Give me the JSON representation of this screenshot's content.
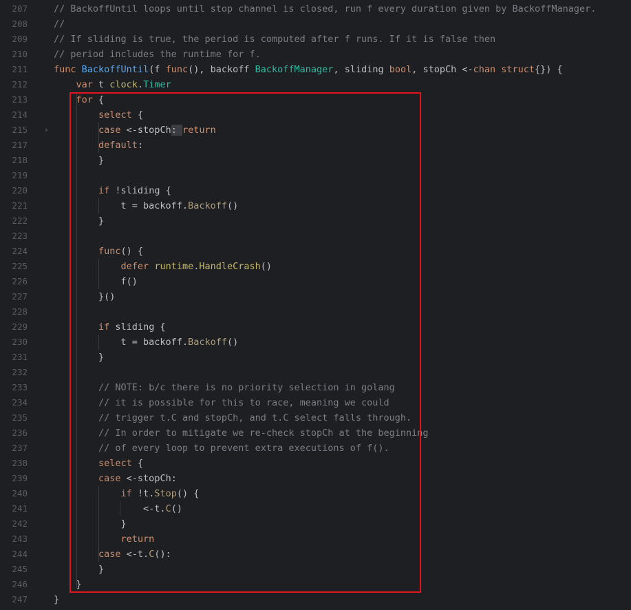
{
  "editor": {
    "lines": [
      {
        "n": "207",
        "tokens": [
          [
            "cm",
            "// BackoffUntil loops until stop channel is closed, run f every duration given by BackoffManager."
          ]
        ]
      },
      {
        "n": "208",
        "tokens": [
          [
            "cm",
            "//"
          ]
        ]
      },
      {
        "n": "209",
        "tokens": [
          [
            "cm",
            "// If sliding is true, the period is computed after f runs. If it is false then"
          ]
        ]
      },
      {
        "n": "210",
        "tokens": [
          [
            "cm",
            "// period includes the runtime for f."
          ]
        ]
      },
      {
        "n": "211",
        "tokens": [
          [
            "kw",
            "func "
          ],
          [
            "fn",
            "BackoffUntil"
          ],
          [
            "",
            "(f "
          ],
          [
            "kw",
            "func"
          ],
          [
            "",
            "(), backoff "
          ],
          [
            "ty",
            "BackoffManager"
          ],
          [
            "",
            ", sliding "
          ],
          [
            "kw",
            "bool"
          ],
          [
            "",
            ", stopCh <-"
          ],
          [
            "kw",
            "chan struct"
          ],
          [
            "",
            "{}) {"
          ]
        ]
      },
      {
        "n": "212",
        "tokens": [
          [
            "",
            "    "
          ],
          [
            "kw",
            "var"
          ],
          [
            "",
            " t "
          ],
          [
            "cl",
            "clock"
          ],
          [
            "",
            "."
          ],
          [
            "ty",
            "Timer"
          ]
        ]
      },
      {
        "n": "213",
        "tokens": [
          [
            "",
            "    "
          ],
          [
            "kw",
            "for"
          ],
          [
            "",
            " {"
          ]
        ]
      },
      {
        "n": "214",
        "tokens": [
          [
            "",
            "        "
          ],
          [
            "kw",
            "select"
          ],
          [
            "",
            " {"
          ]
        ]
      },
      {
        "n": "215",
        "fold": true,
        "tokens": [
          [
            "",
            "        "
          ],
          [
            "kw",
            "case"
          ],
          [
            "",
            " <-stopCh"
          ],
          [
            "hl",
            ": "
          ],
          [
            "kw",
            "return"
          ]
        ]
      },
      {
        "n": "217",
        "tokens": [
          [
            "",
            "        "
          ],
          [
            "kw",
            "default"
          ],
          [
            "",
            ":"
          ]
        ]
      },
      {
        "n": "218",
        "tokens": [
          [
            "",
            "        }"
          ]
        ]
      },
      {
        "n": "219",
        "tokens": []
      },
      {
        "n": "220",
        "tokens": [
          [
            "",
            "        "
          ],
          [
            "kw",
            "if"
          ],
          [
            "",
            " !sliding {"
          ]
        ]
      },
      {
        "n": "221",
        "tokens": [
          [
            "",
            "            t = backoff."
          ],
          [
            "mt",
            "Backoff"
          ],
          [
            "",
            "()"
          ]
        ]
      },
      {
        "n": "222",
        "tokens": [
          [
            "",
            "        }"
          ]
        ]
      },
      {
        "n": "223",
        "tokens": []
      },
      {
        "n": "224",
        "tokens": [
          [
            "",
            "        "
          ],
          [
            "kw",
            "func"
          ],
          [
            "",
            "() {"
          ]
        ]
      },
      {
        "n": "225",
        "tokens": [
          [
            "",
            "            "
          ],
          [
            "kw",
            "defer "
          ],
          [
            "cl",
            "runtime"
          ],
          [
            "",
            "."
          ],
          [
            "cl",
            "HandleCrash"
          ],
          [
            "",
            "()"
          ]
        ]
      },
      {
        "n": "226",
        "tokens": [
          [
            "",
            "            f()"
          ]
        ]
      },
      {
        "n": "227",
        "tokens": [
          [
            "",
            "        }()"
          ]
        ]
      },
      {
        "n": "228",
        "tokens": []
      },
      {
        "n": "229",
        "tokens": [
          [
            "",
            "        "
          ],
          [
            "kw",
            "if"
          ],
          [
            "",
            " sliding {"
          ]
        ]
      },
      {
        "n": "230",
        "tokens": [
          [
            "",
            "            t = backoff."
          ],
          [
            "mt",
            "Backoff"
          ],
          [
            "",
            "()"
          ]
        ]
      },
      {
        "n": "231",
        "tokens": [
          [
            "",
            "        }"
          ]
        ]
      },
      {
        "n": "232",
        "tokens": []
      },
      {
        "n": "233",
        "tokens": [
          [
            "",
            "        "
          ],
          [
            "cm",
            "// NOTE: b/c there is no priority selection in golang"
          ]
        ]
      },
      {
        "n": "234",
        "tokens": [
          [
            "",
            "        "
          ],
          [
            "cm",
            "// it is possible for this to race, meaning we could"
          ]
        ]
      },
      {
        "n": "235",
        "tokens": [
          [
            "",
            "        "
          ],
          [
            "cm",
            "// trigger t.C and stopCh, and t.C select falls through."
          ]
        ]
      },
      {
        "n": "236",
        "tokens": [
          [
            "",
            "        "
          ],
          [
            "cm",
            "// In order to mitigate we re-check stopCh at the beginning"
          ]
        ]
      },
      {
        "n": "237",
        "tokens": [
          [
            "",
            "        "
          ],
          [
            "cm",
            "// of every loop to prevent extra executions of f()."
          ]
        ]
      },
      {
        "n": "238",
        "tokens": [
          [
            "",
            "        "
          ],
          [
            "kw",
            "select"
          ],
          [
            "",
            " {"
          ]
        ]
      },
      {
        "n": "239",
        "tokens": [
          [
            "",
            "        "
          ],
          [
            "kw",
            "case"
          ],
          [
            "",
            " <-stopCh:"
          ]
        ]
      },
      {
        "n": "240",
        "tokens": [
          [
            "",
            "            "
          ],
          [
            "kw",
            "if"
          ],
          [
            "",
            " !t."
          ],
          [
            "mt",
            "Stop"
          ],
          [
            "",
            "() {"
          ]
        ]
      },
      {
        "n": "241",
        "tokens": [
          [
            "",
            "                <-t."
          ],
          [
            "mt",
            "C"
          ],
          [
            "",
            "()"
          ]
        ]
      },
      {
        "n": "242",
        "tokens": [
          [
            "",
            "            }"
          ]
        ]
      },
      {
        "n": "243",
        "tokens": [
          [
            "",
            "            "
          ],
          [
            "kw",
            "return"
          ]
        ]
      },
      {
        "n": "244",
        "tokens": [
          [
            "",
            "        "
          ],
          [
            "kw",
            "case"
          ],
          [
            "",
            " <-t."
          ],
          [
            "mt",
            "C"
          ],
          [
            "",
            "():"
          ]
        ]
      },
      {
        "n": "245",
        "tokens": [
          [
            "",
            "        }"
          ]
        ]
      },
      {
        "n": "246",
        "tokens": [
          [
            "",
            "    }"
          ]
        ]
      },
      {
        "n": "247",
        "tokens": [
          [
            "",
            "}"
          ]
        ]
      }
    ]
  },
  "colors": {
    "background": "#1e1f22",
    "keyword": "#cf8e6d",
    "comment": "#7a7e85",
    "function": "#56a8f5",
    "type": "#2fbaa3",
    "method": "#b09d79",
    "highlight_box": "#e0151d"
  },
  "icons": {
    "fold": "fold-chevron-icon"
  }
}
